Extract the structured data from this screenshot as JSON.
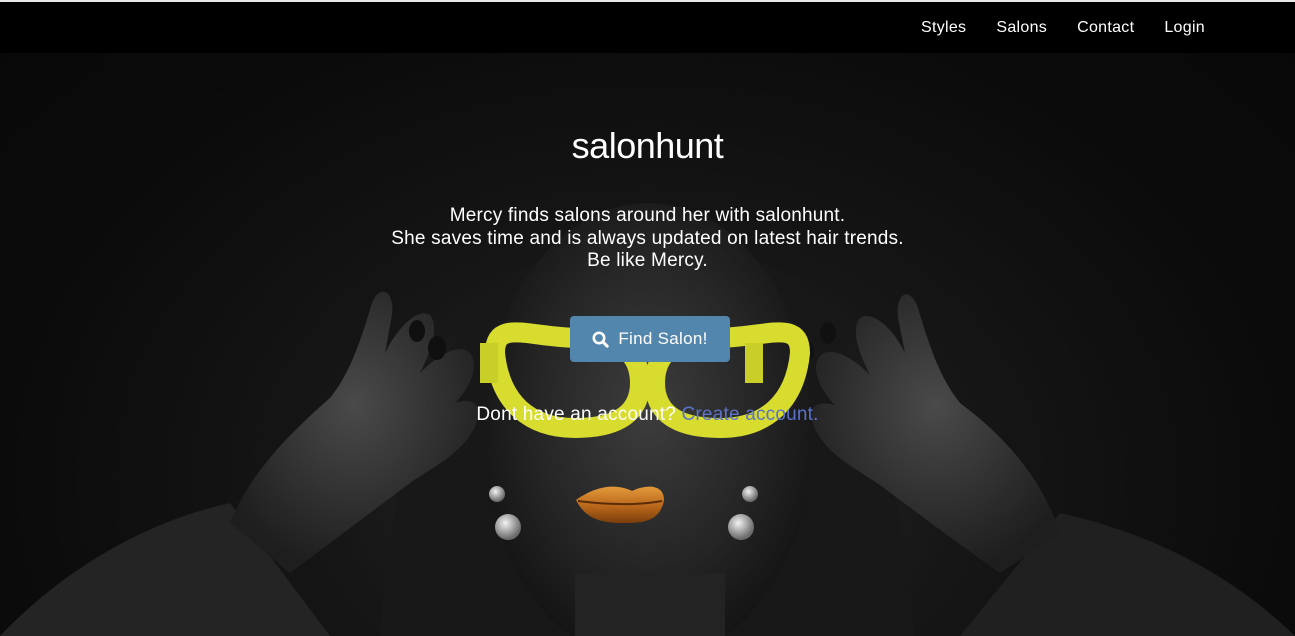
{
  "nav": {
    "items": [
      {
        "label": "Styles"
      },
      {
        "label": "Salons"
      },
      {
        "label": "Contact"
      },
      {
        "label": "Login"
      }
    ]
  },
  "hero": {
    "brand": "salonhunt",
    "tagline": [
      "Mercy finds salons around her with salonhunt.",
      "She saves time and is always updated on latest hair trends.",
      "Be like Mercy."
    ],
    "find_button": {
      "label": "Find Salon!",
      "icon": "search-icon"
    },
    "account_prompt": "Dont have an account?",
    "create_account_link": "Create account."
  },
  "colors": {
    "navbar": "#000000",
    "button": "#5386ad",
    "link": "#5b73c9",
    "glasses": "#d7dc2e",
    "lips": "#c77a1e"
  }
}
